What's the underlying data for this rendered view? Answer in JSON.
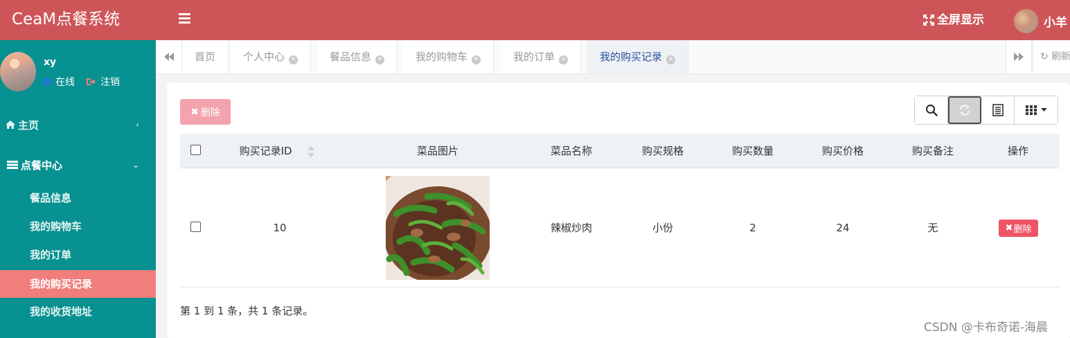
{
  "header": {
    "brand": "CeaM点餐系统",
    "fullscreen": "全屏显示",
    "user": "小羊",
    "accent": "#cd5558"
  },
  "sidebar": {
    "username": "xy",
    "status": "在线",
    "logout": "注销",
    "home": "主页",
    "center": "点餐中心",
    "items": [
      {
        "label": "餐品信息"
      },
      {
        "label": "我的购物车"
      },
      {
        "label": "我的订单"
      },
      {
        "label": "我的购买记录"
      },
      {
        "label": "我的收货地址"
      }
    ],
    "color": "#079190",
    "active_color": "#ef7e7c"
  },
  "tabs": {
    "items": [
      {
        "label": "首页"
      },
      {
        "label": "个人中心"
      },
      {
        "label": "餐品信息"
      },
      {
        "label": "我的购物车"
      },
      {
        "label": "我的订单"
      },
      {
        "label": "我的购买记录"
      }
    ],
    "refresh": "刷新"
  },
  "content": {
    "delete_button": "删除",
    "columns": [
      "购买记录ID",
      "菜品图片",
      "菜品名称",
      "购买规格",
      "购买数量",
      "购买价格",
      "购买备注",
      "操作"
    ],
    "rows": [
      {
        "id": "10",
        "name": "辣椒炒肉",
        "spec": "小份",
        "qty": "2",
        "price": "24",
        "note": "无",
        "action": "删除"
      }
    ],
    "pager": "第 1 到 1 条，共 1 条记录。"
  },
  "watermark": "CSDN @卡布奇诺-海晨"
}
